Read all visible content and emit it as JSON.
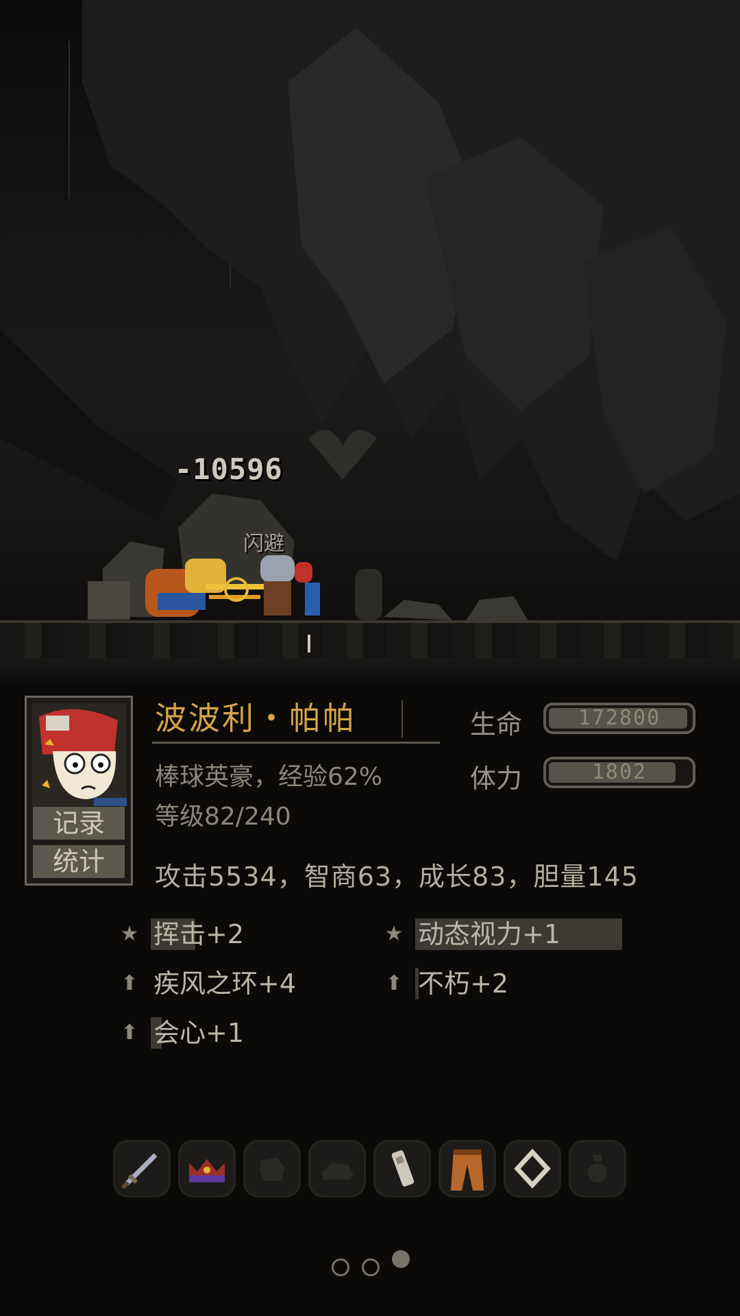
{
  "battle": {
    "damage_text": "-10596",
    "miss_text": "闪避"
  },
  "hero": {
    "name": "波波利・帕帕",
    "title_line": "棒球英豪，经验62%",
    "level_line": "等级82/240",
    "attributes_line": "攻击5534，智商63，成长83，胆量145",
    "record_button": "记录",
    "stats_button": "统计"
  },
  "vitals": {
    "hp_label": "生命",
    "hp_value": "172800",
    "hp_fill": 0.98,
    "stamina_label": "体力",
    "stamina_value": "1802",
    "stamina_fill": 0.9
  },
  "skills": [
    {
      "label": "挥击+2",
      "icon": "star-icon",
      "highlight_fraction": 0.48
    },
    {
      "label": "动态视力+1",
      "icon": "star-icon",
      "highlight_fraction": 1.0
    },
    {
      "label": "疾风之环+4",
      "icon": "arrow-up-icon",
      "highlight_fraction": 0.0
    },
    {
      "label": "不朽+2",
      "icon": "arrow-up-icon",
      "highlight_fraction": 0.04
    },
    {
      "label": "会心+1",
      "icon": "arrow-up-icon",
      "highlight_fraction": 0.12
    }
  ],
  "equipment": [
    {
      "icon": "sword-icon",
      "filled": true
    },
    {
      "icon": "crown-icon",
      "filled": true
    },
    {
      "icon": "glove-icon",
      "filled": false
    },
    {
      "icon": "boots-icon",
      "filled": false
    },
    {
      "icon": "bandage-icon",
      "filled": true
    },
    {
      "icon": "pants-icon",
      "filled": true
    },
    {
      "icon": "ring-icon",
      "filled": true
    },
    {
      "icon": "potion-icon",
      "filled": false
    }
  ],
  "pager": {
    "count": 3,
    "active": 2
  },
  "colors": {
    "accent_gold": "#d6a44a",
    "panel_bg": "#0b0a09",
    "bar_fill": "#57534a"
  }
}
